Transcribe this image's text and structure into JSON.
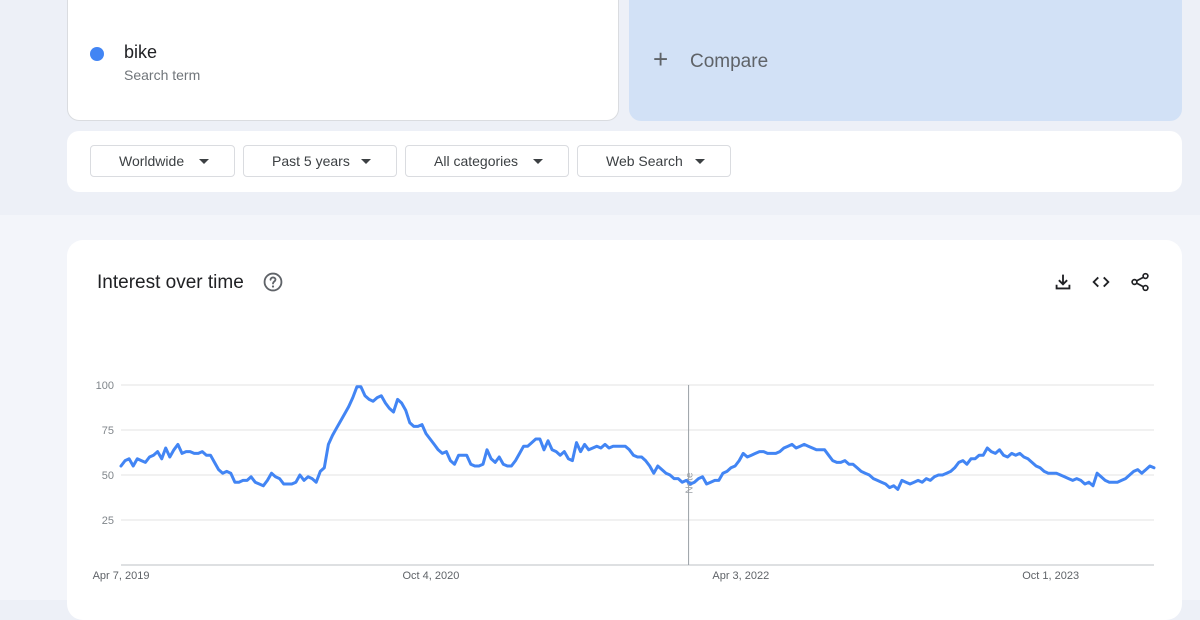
{
  "search_term": {
    "name": "bike",
    "type_label": "Search term",
    "color": "#4285f4"
  },
  "compare": {
    "label": "Compare",
    "icon": "plus-icon",
    "background": "#d2e1f6",
    "text_color": "#5f6368"
  },
  "filters": [
    {
      "label": "Worldwide"
    },
    {
      "label": "Past 5 years"
    },
    {
      "label": "All categories"
    },
    {
      "label": "Web Search"
    }
  ],
  "chart": {
    "title": "Interest over time",
    "help_icon": "help-circle-icon",
    "tools": [
      "download-icon",
      "embed-code-icon",
      "share-icon"
    ],
    "note_label": "Note"
  },
  "chart_data": {
    "type": "line",
    "title": "Interest over time",
    "xlabel": "",
    "ylabel": "",
    "ylim": [
      0,
      100
    ],
    "yticks": [
      25,
      50,
      75,
      100
    ],
    "grid": true,
    "x_range": [
      "2019-04-07",
      "2024-03-31"
    ],
    "xticks": [
      {
        "date": "2019-04-07",
        "label": "Apr 7, 2019"
      },
      {
        "date": "2020-10-04",
        "label": "Oct 4, 2020"
      },
      {
        "date": "2022-04-03",
        "label": "Apr 3, 2022"
      },
      {
        "date": "2023-10-01",
        "label": "Oct 1, 2023"
      }
    ],
    "note_date": "2022-01-01",
    "series": [
      {
        "color": "#4285f4",
        "values": [
          55,
          58,
          59,
          55,
          59,
          58,
          57,
          60,
          61,
          63,
          59,
          65,
          60,
          64,
          67,
          62,
          63,
          63,
          62,
          62,
          63,
          61,
          61,
          57,
          53,
          51,
          52,
          51,
          46,
          46,
          47,
          47,
          49,
          46,
          45,
          44,
          47,
          51,
          49,
          48,
          45,
          45,
          45,
          46,
          50,
          47,
          49,
          48,
          46,
          52,
          54,
          67,
          72,
          76,
          80,
          84,
          88,
          93,
          99,
          99,
          94,
          92,
          91,
          93,
          94,
          90,
          87,
          85,
          92,
          90,
          86,
          79,
          77,
          77,
          78,
          73,
          70,
          67,
          64,
          62,
          63,
          58,
          56,
          61,
          61,
          61,
          56,
          55,
          55,
          56,
          64,
          59,
          57,
          60,
          56,
          55,
          55,
          58,
          62,
          66,
          66,
          68,
          70,
          70,
          64,
          69,
          64,
          63,
          61,
          63,
          59,
          58,
          68,
          63,
          67,
          64,
          65,
          66,
          65,
          67,
          65,
          66,
          66,
          66,
          66,
          64,
          61,
          60,
          60,
          58,
          55,
          51,
          55,
          53,
          51,
          50,
          48,
          48,
          46,
          47,
          45,
          46,
          48,
          49,
          45,
          46,
          47,
          47,
          51,
          52,
          54,
          55,
          58,
          62,
          60,
          61,
          62,
          63,
          63,
          62,
          62,
          62,
          63,
          65,
          66,
          67,
          65,
          66,
          67,
          66,
          65,
          64,
          64,
          64,
          61,
          58,
          57,
          57,
          58,
          56,
          56,
          54,
          52,
          51,
          50,
          48,
          47,
          46,
          45,
          43,
          44,
          42,
          47,
          46,
          45,
          46,
          47,
          46,
          48,
          47,
          49,
          50,
          50,
          51,
          52,
          54,
          57,
          58,
          56,
          59,
          59,
          61,
          61,
          65,
          63,
          62,
          64,
          61,
          60,
          62,
          61,
          62,
          60,
          59,
          57,
          55,
          54,
          52,
          51,
          51,
          51,
          50,
          49,
          48,
          47,
          48,
          47,
          45,
          46,
          44,
          51,
          49,
          47,
          46,
          46,
          46,
          47,
          48,
          50,
          52,
          53,
          51,
          53,
          55,
          54
        ]
      }
    ]
  }
}
